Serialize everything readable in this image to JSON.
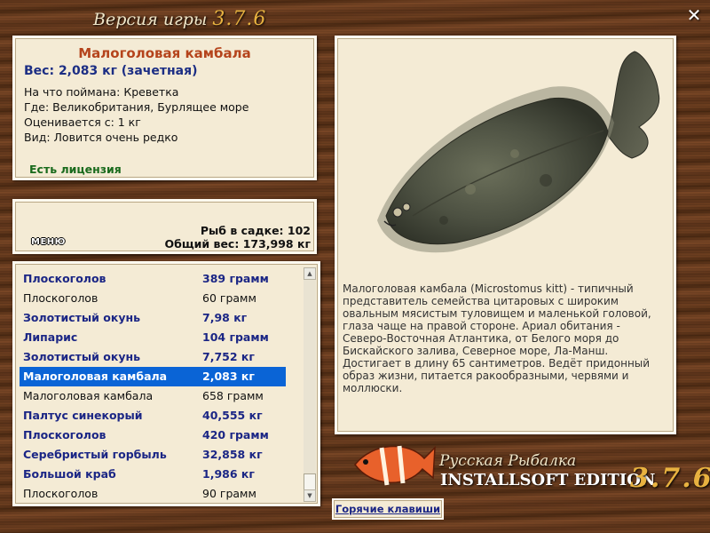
{
  "window": {
    "title_prefix": "Версия игры",
    "title_version": "3.7.6",
    "close_glyph": "✕"
  },
  "catch": {
    "name": "Малоголовая камбала",
    "weight_line": "Вес: 2,083 кг (зачетная)",
    "bait": "На что поймана: Креветка",
    "location": "Где: Великобритания, Бурлящее море",
    "rated_from": "Оценивается с: 1 кг",
    "rarity": "Вид: Ловится очень редко",
    "license": "Есть лицензия"
  },
  "stats": {
    "menu_label": "МЕНЮ",
    "fish_in_net": "Рыб в садке: 102",
    "total_weight": "Общий вес: 173,998 кг"
  },
  "catch_list": [
    {
      "name": "Плоскоголов",
      "weight": "389 грамм",
      "style": "bold"
    },
    {
      "name": "Плоскоголов",
      "weight": "60 грамм",
      "style": "plain"
    },
    {
      "name": "Золотистый окунь",
      "weight": "7,98 кг",
      "style": "bold"
    },
    {
      "name": "Липарис",
      "weight": "104 грамм",
      "style": "bold"
    },
    {
      "name": "Золотистый окунь",
      "weight": "7,752 кг",
      "style": "bold"
    },
    {
      "name": "Малоголовая камбала",
      "weight": "2,083 кг",
      "style": "selected"
    },
    {
      "name": "Малоголовая камбала",
      "weight": "658 грамм",
      "style": "plain"
    },
    {
      "name": "Палтус синекорый",
      "weight": "40,555 кг",
      "style": "bold"
    },
    {
      "name": "Плоскоголов",
      "weight": "420 грамм",
      "style": "bold"
    },
    {
      "name": "Серебристый горбыль",
      "weight": "32,858 кг",
      "style": "bold"
    },
    {
      "name": "Большой краб",
      "weight": "1,986 кг",
      "style": "bold"
    },
    {
      "name": "Плоскоголов",
      "weight": "90 грамм",
      "style": "plain"
    }
  ],
  "fish_info": {
    "description": "Малоголовая камбала (Microstomus kitt) - типичный представитель семейства цитаровых с широким овальным мясистым туловищем и маленькой головой, глаза чаще на правой стороне. Ариал обитания - Северо-Восточная Атлантика, от Белого моря до Бискайского залива, Северное море, Ла-Манш. Достигает в длину 65 сантиметров. Ведёт придонный образ жизни, питается ракообразными, червями и моллюски."
  },
  "footer": {
    "hotkeys_label": "Горячие клавиши",
    "brand_line1": "Русская Рыбалка",
    "brand_line2": "INSTALLSOFT EDITION",
    "brand_version": "3.7.6"
  },
  "colors": {
    "panel_bg": "#f4ebd5",
    "accent_name": "#b5441c",
    "accent_blue": "#1b2685",
    "license_green": "#196a1c",
    "selection": "#0a64d6",
    "version_gold": "#e8b240"
  }
}
